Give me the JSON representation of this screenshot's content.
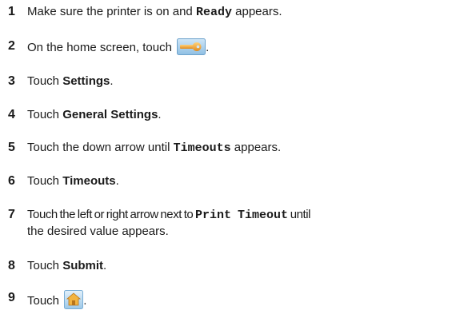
{
  "steps": [
    {
      "num": "1",
      "a": "Make sure the printer is on and ",
      "code": "Ready",
      "b": " appears."
    },
    {
      "num": "2",
      "a": "On the home screen, touch ",
      "b": ".",
      "icon": "wrench-key-icon"
    },
    {
      "num": "3",
      "a": "Touch ",
      "strong": "Settings",
      "b": "."
    },
    {
      "num": "4",
      "a": "Touch ",
      "strong": "General Settings",
      "b": "."
    },
    {
      "num": "5",
      "a": "Touch the down arrow until ",
      "code": "Timeouts",
      "b": " appears."
    },
    {
      "num": "6",
      "a": "Touch ",
      "strong": "Timeouts",
      "b": "."
    },
    {
      "num": "7",
      "a": "Touch the left or right arrow next to ",
      "code": "Print Timeout",
      "b": " until",
      "line2": "the desired value appears."
    },
    {
      "num": "8",
      "a": "Touch ",
      "strong": "Submit",
      "b": "."
    },
    {
      "num": "9",
      "a": "Touch ",
      "b": ".",
      "icon": "home-icon"
    }
  ]
}
